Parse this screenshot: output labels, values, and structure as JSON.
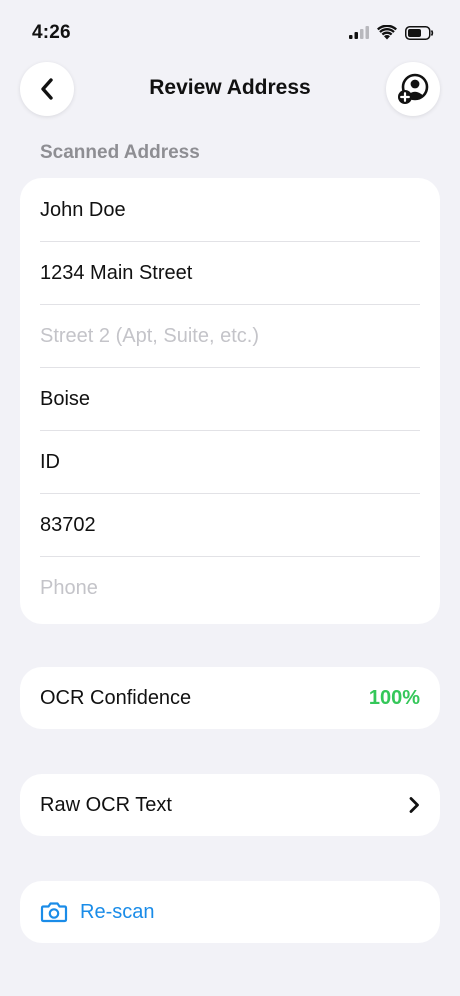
{
  "status_bar": {
    "time": "4:26"
  },
  "nav": {
    "title": "Review Address"
  },
  "section": {
    "label": "Scanned Address"
  },
  "address": {
    "fields": [
      {
        "value": "John Doe",
        "placeholder": false
      },
      {
        "value": "1234 Main Street",
        "placeholder": false
      },
      {
        "value": "Street 2 (Apt, Suite, etc.)",
        "placeholder": true
      },
      {
        "value": "Boise",
        "placeholder": false
      },
      {
        "value": "ID",
        "placeholder": false
      },
      {
        "value": "83702",
        "placeholder": false
      },
      {
        "value": "Phone",
        "placeholder": true
      }
    ]
  },
  "ocr": {
    "label": "OCR Confidence",
    "value": "100%"
  },
  "raw": {
    "label": "Raw OCR Text"
  },
  "rescan": {
    "label": "Re-scan"
  },
  "colors": {
    "accent_blue": "#1a8ce8",
    "success_green": "#34c759",
    "background": "#f2f2f7",
    "placeholder_gray": "#c4c4c9"
  }
}
